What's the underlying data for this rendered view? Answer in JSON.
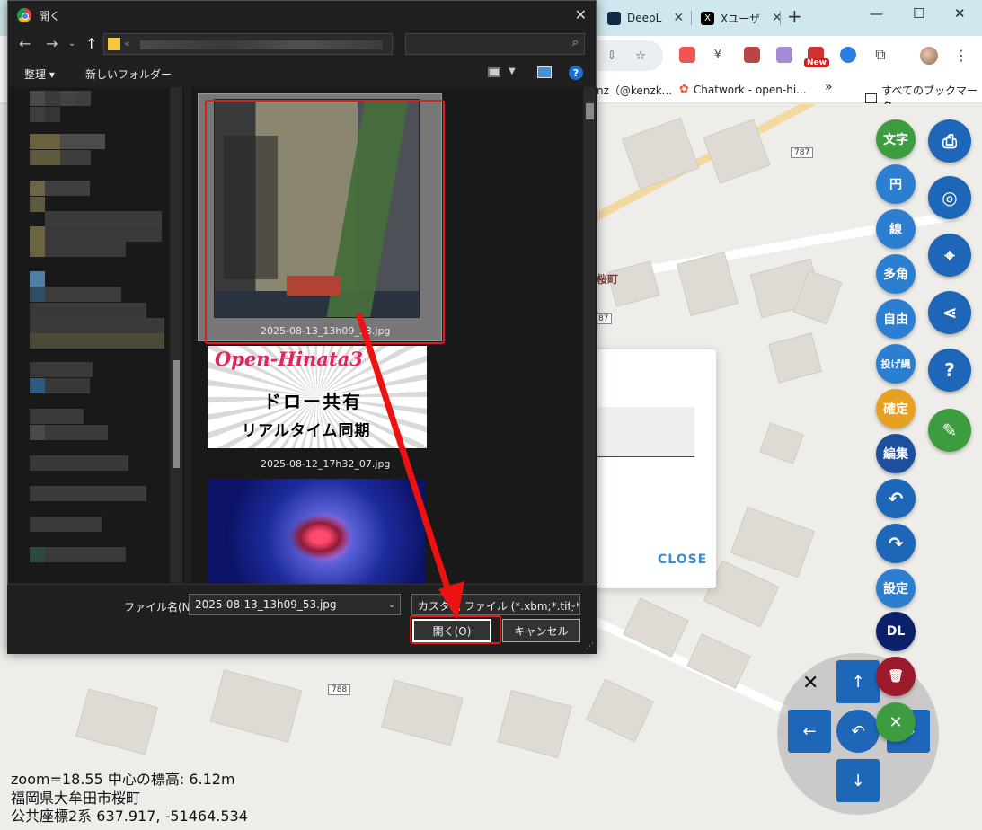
{
  "browser": {
    "tabs": [
      {
        "label": "DeepL",
        "icon": "deepl-icon"
      },
      {
        "label": "Xユーザ",
        "icon": "x-icon"
      }
    ],
    "new_tab": "+",
    "window_controls": {
      "minimize": "—",
      "maximize": "☐",
      "close": "✕"
    },
    "ext_new_badge": "New",
    "bookmarks": [
      {
        "label": "nz（@kenzk..."
      },
      {
        "label": "Chatwork - open-hi..."
      },
      {
        "label": "»"
      },
      {
        "label": "すべてのブックマーク"
      }
    ]
  },
  "dialog": {
    "title": "開く",
    "toolbar": {
      "organize": "整理 ▾",
      "new_folder": "新しいフォルダー",
      "help": "?"
    },
    "files": [
      {
        "name": "2025-08-13_13h09_53.jpg",
        "selected": true
      },
      {
        "name": "2025-08-12_17h32_07.jpg",
        "selected": false
      },
      {
        "name": "",
        "selected": false
      }
    ],
    "thumb2_text": {
      "line1": "Open-Hinata3",
      "line2": "ドロー共有",
      "line3": "リアルタイム同期"
    },
    "filename_label": "ファイル名(N):",
    "filename_value": "2025-08-13_13h09_53.jpg",
    "filetype_value": "カスタム ファイル (*.xbm;*.tif;*.pjp;",
    "open_button": "開く(O)",
    "cancel_button": "キャンセル"
  },
  "map": {
    "road_numbers": [
      "787",
      "788",
      "87"
    ],
    "area_label": "桜町",
    "info": {
      "line1": "zoom=18.55 中心の標高: 6.12m",
      "line2": "福岡県大牟田市桜町",
      "line3": "公共座標2系 637.917, -51464.534"
    }
  },
  "modal": {
    "close": "CLOSE"
  },
  "tools": {
    "left_column": [
      {
        "label": "文字",
        "color": "#3d9c3f"
      },
      {
        "label": "円",
        "color": "#2c7fd0"
      },
      {
        "label": "線",
        "color": "#2c7fd0"
      },
      {
        "label": "多角",
        "color": "#2c7fd0"
      },
      {
        "label": "自由",
        "color": "#2c7fd0"
      },
      {
        "label": "投げ縄",
        "color": "#2c7fd0"
      },
      {
        "label": "確定",
        "color": "#e8a020"
      },
      {
        "label": "編集",
        "color": "#1e4f9c"
      },
      {
        "label": "↶",
        "color": "#1e67b8"
      },
      {
        "label": "↷",
        "color": "#1e67b8"
      },
      {
        "label": "設定",
        "color": "#2c7fd0"
      },
      {
        "label": "DL",
        "color": "#0b1f6b"
      },
      {
        "label": "🗑",
        "color": "#9b1b2c"
      },
      {
        "label": "✕",
        "color": "#3d9c3f"
      }
    ],
    "right_column": [
      {
        "icon": "print-icon",
        "glyph": "⎙"
      },
      {
        "icon": "target-icon",
        "glyph": "◎"
      },
      {
        "icon": "location-pin-icon",
        "glyph": "⌖"
      },
      {
        "icon": "share-icon",
        "glyph": "⋖"
      },
      {
        "icon": "help-icon",
        "glyph": "?"
      },
      {
        "icon": "pencil-icon",
        "glyph": "✎"
      }
    ],
    "pad": {
      "up": "↑",
      "down": "↓",
      "left": "←",
      "right": "→",
      "center": "↶",
      "close": "✕"
    }
  }
}
